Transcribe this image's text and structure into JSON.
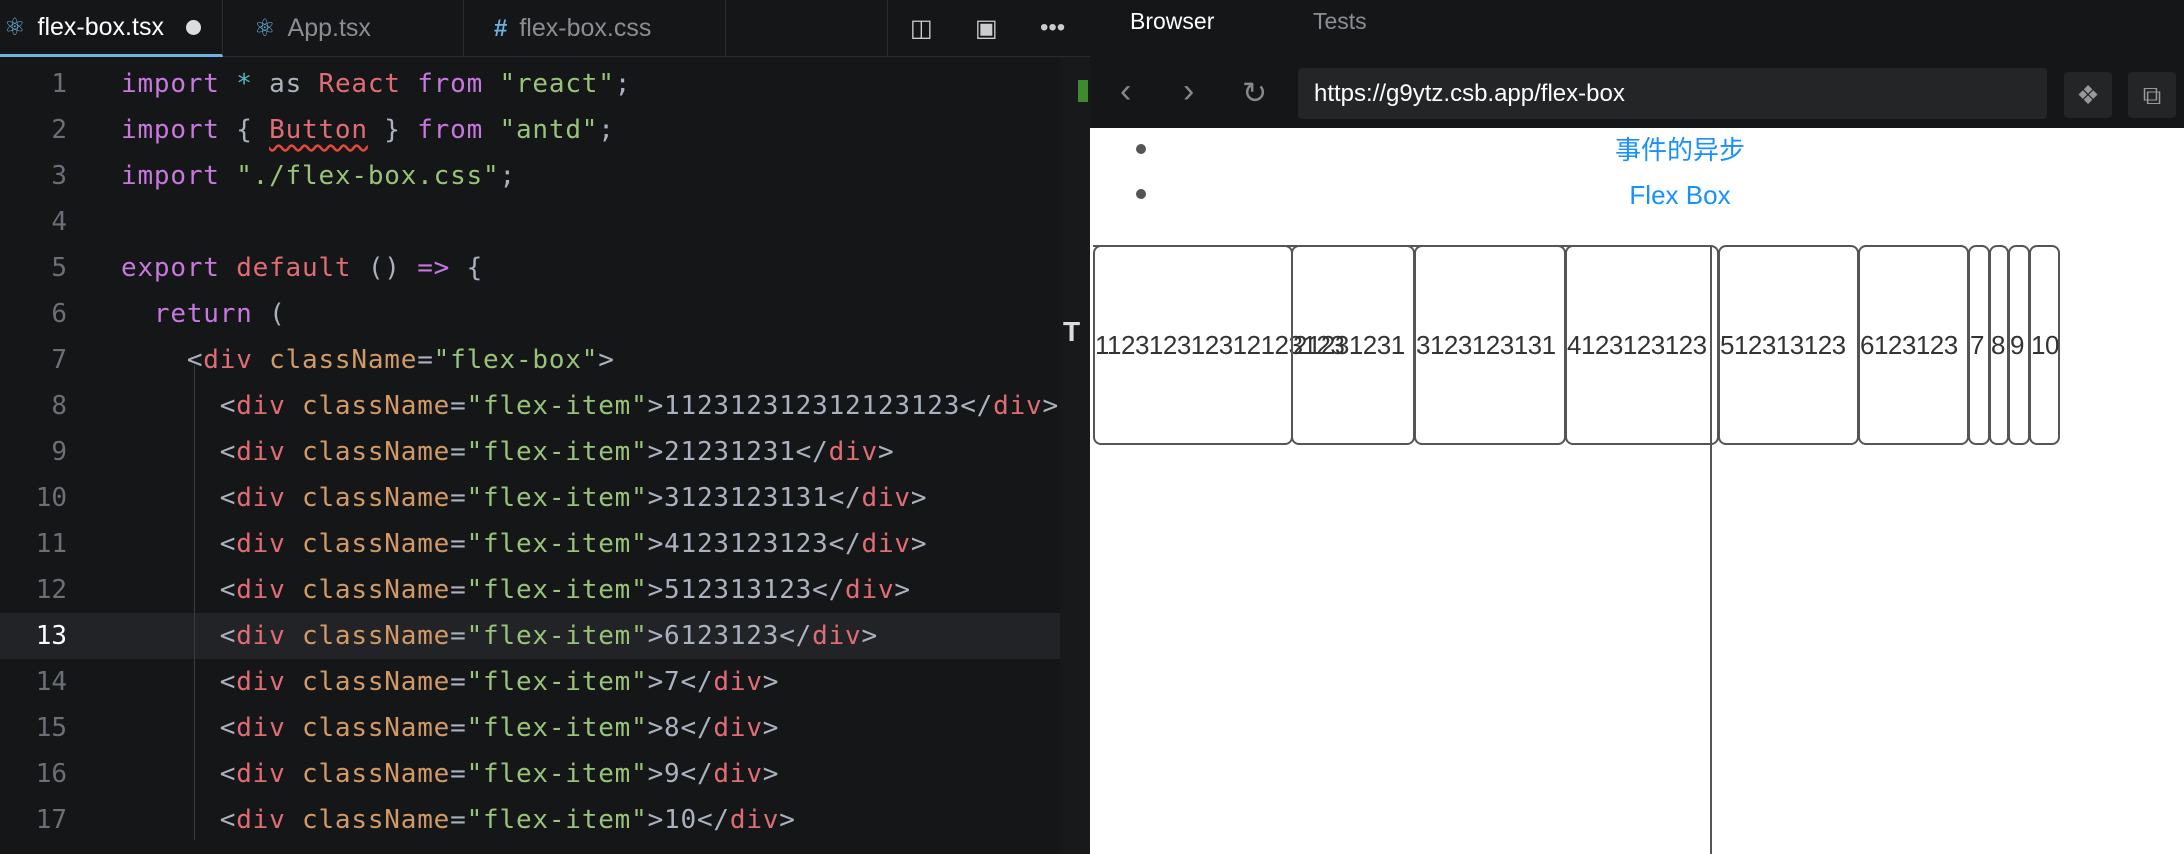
{
  "editor": {
    "tabs": [
      {
        "label": "flex-box.tsx",
        "icon": "react-icon",
        "modified": true,
        "active": true
      },
      {
        "label": "App.tsx",
        "icon": "react-icon"
      },
      {
        "label": "flex-box.css",
        "icon": "hash-icon"
      }
    ],
    "toolbar": [
      "split-editor-icon",
      "preview-icon",
      "more-icon"
    ],
    "current_line": 13,
    "lines": [
      [
        [
          "kw",
          "import"
        ],
        [
          "op",
          " *"
        ],
        [
          "pu",
          " as "
        ],
        [
          "id",
          "React"
        ],
        [
          "kw",
          " from"
        ],
        [
          "st",
          " \"react\""
        ],
        [
          "pu",
          ";"
        ]
      ],
      [
        [
          "kw",
          "import"
        ],
        [
          "pu",
          " { "
        ],
        [
          "err",
          "Button"
        ],
        [
          "pu",
          " } "
        ],
        [
          "kw",
          "from"
        ],
        [
          "st",
          " \"antd\""
        ],
        [
          "pu",
          ";"
        ]
      ],
      [
        [
          "kw",
          "import"
        ],
        [
          "st",
          " \"./flex-box.css\""
        ],
        [
          "pu",
          ";"
        ]
      ],
      [],
      [
        [
          "kw",
          "export"
        ],
        [
          "id",
          " default"
        ],
        [
          "pu",
          " () "
        ],
        [
          "kw",
          "=>"
        ],
        [
          "pu",
          " {"
        ]
      ],
      [
        [
          "kw",
          "  return"
        ],
        [
          "pu",
          " ("
        ]
      ],
      [
        [
          "pu",
          "    <"
        ],
        [
          "tg",
          "div"
        ],
        [
          "at",
          " className"
        ],
        [
          "pu",
          "="
        ],
        [
          "st",
          "\"flex-box\""
        ],
        [
          "pu",
          ">"
        ]
      ],
      [
        [
          "pu",
          "      <"
        ],
        [
          "tg",
          "div"
        ],
        [
          "at",
          " className"
        ],
        [
          "pu",
          "="
        ],
        [
          "st",
          "\"flex-item\""
        ],
        [
          "pu",
          ">112312312312123123</"
        ],
        [
          "tg",
          "div"
        ],
        [
          "pu",
          ">"
        ]
      ],
      [
        [
          "pu",
          "      <"
        ],
        [
          "tg",
          "div"
        ],
        [
          "at",
          " className"
        ],
        [
          "pu",
          "="
        ],
        [
          "st",
          "\"flex-item\""
        ],
        [
          "pu",
          ">21231231</"
        ],
        [
          "tg",
          "div"
        ],
        [
          "pu",
          ">"
        ]
      ],
      [
        [
          "pu",
          "      <"
        ],
        [
          "tg",
          "div"
        ],
        [
          "at",
          " className"
        ],
        [
          "pu",
          "="
        ],
        [
          "st",
          "\"flex-item\""
        ],
        [
          "pu",
          ">3123123131</"
        ],
        [
          "tg",
          "div"
        ],
        [
          "pu",
          ">"
        ]
      ],
      [
        [
          "pu",
          "      <"
        ],
        [
          "tg",
          "div"
        ],
        [
          "at",
          " className"
        ],
        [
          "pu",
          "="
        ],
        [
          "st",
          "\"flex-item\""
        ],
        [
          "pu",
          ">4123123123</"
        ],
        [
          "tg",
          "div"
        ],
        [
          "pu",
          ">"
        ]
      ],
      [
        [
          "pu",
          "      <"
        ],
        [
          "tg",
          "div"
        ],
        [
          "at",
          " className"
        ],
        [
          "pu",
          "="
        ],
        [
          "st",
          "\"flex-item\""
        ],
        [
          "pu",
          ">512313123</"
        ],
        [
          "tg",
          "div"
        ],
        [
          "pu",
          ">"
        ]
      ],
      [
        [
          "pu",
          "      <"
        ],
        [
          "tg",
          "div"
        ],
        [
          "at",
          " className"
        ],
        [
          "pu",
          "="
        ],
        [
          "st",
          "\"flex-item\""
        ],
        [
          "pu",
          ">6123123</"
        ],
        [
          "tg",
          "div"
        ],
        [
          "pu",
          ">"
        ]
      ],
      [
        [
          "pu",
          "      <"
        ],
        [
          "tg",
          "div"
        ],
        [
          "at",
          " className"
        ],
        [
          "pu",
          "="
        ],
        [
          "st",
          "\"flex-item\""
        ],
        [
          "pu",
          ">7</"
        ],
        [
          "tg",
          "div"
        ],
        [
          "pu",
          ">"
        ]
      ],
      [
        [
          "pu",
          "      <"
        ],
        [
          "tg",
          "div"
        ],
        [
          "at",
          " className"
        ],
        [
          "pu",
          "="
        ],
        [
          "st",
          "\"flex-item\""
        ],
        [
          "pu",
          ">8</"
        ],
        [
          "tg",
          "div"
        ],
        [
          "pu",
          ">"
        ]
      ],
      [
        [
          "pu",
          "      <"
        ],
        [
          "tg",
          "div"
        ],
        [
          "at",
          " className"
        ],
        [
          "pu",
          "="
        ],
        [
          "st",
          "\"flex-item\""
        ],
        [
          "pu",
          ">9</"
        ],
        [
          "tg",
          "div"
        ],
        [
          "pu",
          ">"
        ]
      ],
      [
        [
          "pu",
          "      <"
        ],
        [
          "tg",
          "div"
        ],
        [
          "at",
          " className"
        ],
        [
          "pu",
          "="
        ],
        [
          "st",
          "\"flex-item\""
        ],
        [
          "pu",
          ">10</"
        ],
        [
          "tg",
          "div"
        ],
        [
          "pu",
          ">"
        ]
      ]
    ]
  },
  "browser": {
    "tabs": {
      "browser": "Browser",
      "tests": "Tests"
    },
    "url": "https://g9ytz.csb.app/flex-box",
    "links": [
      "事件的异步",
      "Flex Box"
    ],
    "link_color": "#1890ff",
    "flex_items": [
      "112312312312123123",
      "21231231",
      "3123123131",
      "4123123123",
      "512313123",
      "6123123",
      "7",
      "8",
      "9",
      "10"
    ]
  }
}
